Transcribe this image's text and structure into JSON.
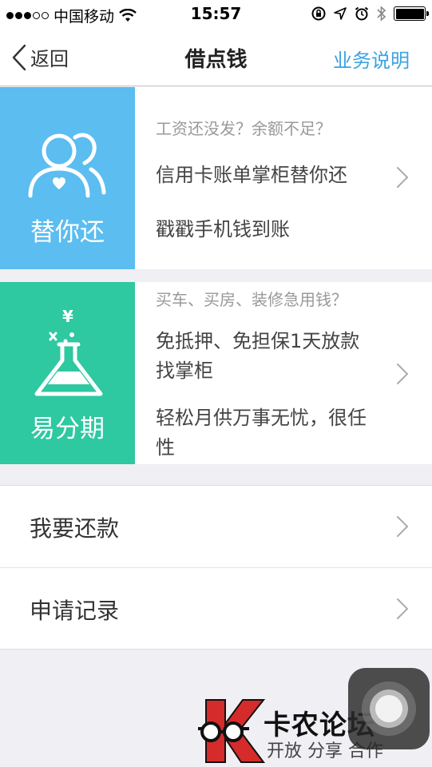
{
  "status_bar": {
    "carrier": "中国移动",
    "time": "15:57"
  },
  "nav": {
    "back_label": "返回",
    "title": "借点钱",
    "action_label": "业务说明"
  },
  "cards": [
    {
      "tile_label": "替你还",
      "tile_color": "#5bbdf0",
      "icon": "people-heart-icon",
      "question": "工资还没发？余额不足？",
      "line1": "信用卡账单掌柜替你还",
      "line2": "戳戳手机钱到账"
    },
    {
      "tile_label": "易分期",
      "tile_color": "#2ec8a1",
      "icon": "flask-yen-icon",
      "question": "买车、买房、装修急用钱？",
      "line1a": "免抵押、免担保1天放款",
      "line1b": "找掌柜",
      "line2a": "轻松月供万事无忧，很任",
      "line2b": "性"
    }
  ],
  "list": [
    {
      "label": "我要还款"
    },
    {
      "label": "申请记录"
    }
  ],
  "watermark": {
    "title": "卡农论坛",
    "subtitle": "开放 分享 合作"
  },
  "colors": {
    "accent": "#3aa3e3",
    "background": "#efeff4"
  }
}
